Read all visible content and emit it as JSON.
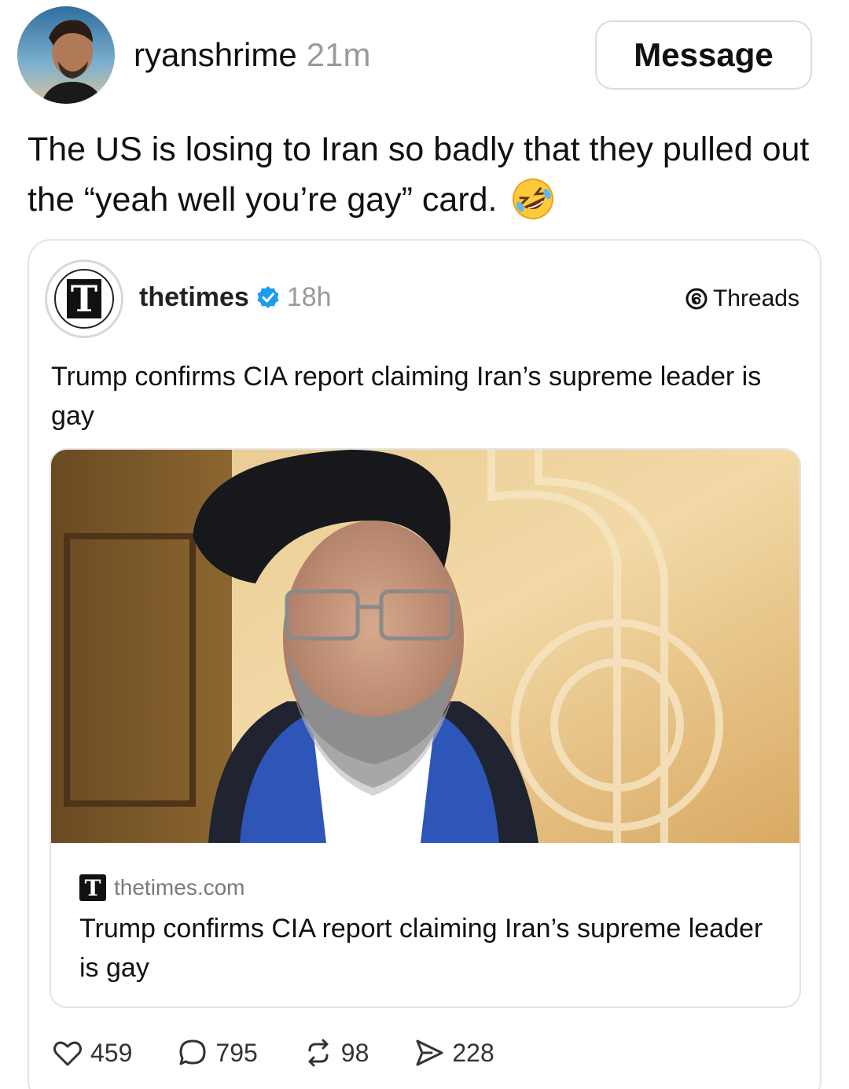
{
  "post": {
    "username": "ryanshrime",
    "time": "21m",
    "message_button": "Message",
    "text": "The US is losing to Iran so badly that they pulled out the “yeah well you’re gay” card.",
    "emoji_icon": "rolling-on-floor-laughing-emoji"
  },
  "quoted": {
    "username": "thetimes",
    "time": "18h",
    "platform_label": "Threads",
    "text": "Trump confirms CIA report claiming Iran’s supreme leader is gay",
    "link_preview": {
      "domain": "thetimes.com",
      "title": "Trump confirms CIA report claiming Iran’s supreme leader is gay"
    },
    "stats": {
      "likes": "459",
      "replies": "795",
      "reposts": "98",
      "shares": "228"
    }
  },
  "colors": {
    "verified_blue": "#1d9bf0",
    "muted_text": "#9a9a9a"
  }
}
